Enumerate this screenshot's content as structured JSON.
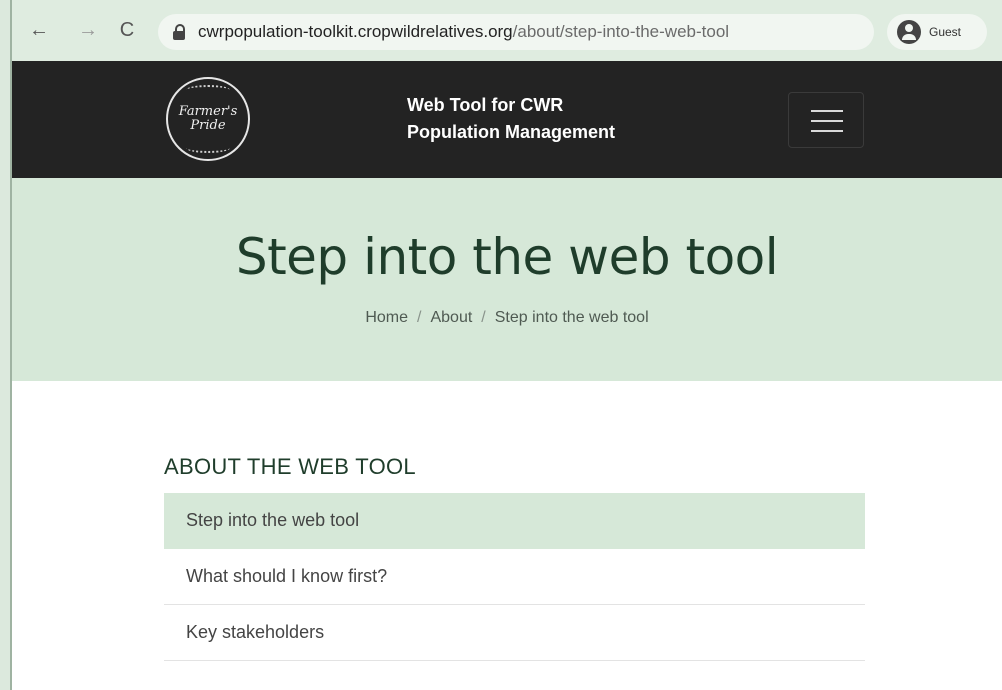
{
  "browser": {
    "url_domain": "cwrpopulation-toolkit.cropwildrelatives.org",
    "url_path": "/about/step-into-the-web-tool",
    "profile_label": "Guest",
    "back_glyph": "←",
    "forward_glyph": "→",
    "reload_glyph": "C"
  },
  "header": {
    "logo_line1": "Farmer's",
    "logo_line2": "Pride",
    "title_line1": "Web Tool for CWR",
    "title_line2": "Population Management"
  },
  "hero": {
    "title": "Step into the web tool",
    "breadcrumb": [
      "Home",
      "About",
      "Step into the web tool"
    ],
    "separator": "/"
  },
  "sidebar": {
    "heading": "ABOUT THE WEB TOOL",
    "items": [
      {
        "label": "Step into the web tool",
        "active": true
      },
      {
        "label": "What should I know first?",
        "active": false
      },
      {
        "label": "Key stakeholders",
        "active": false
      }
    ]
  },
  "colors": {
    "accent_green": "#d6e8d8",
    "header_dark": "#232323",
    "title_green": "#1f3d2b"
  }
}
